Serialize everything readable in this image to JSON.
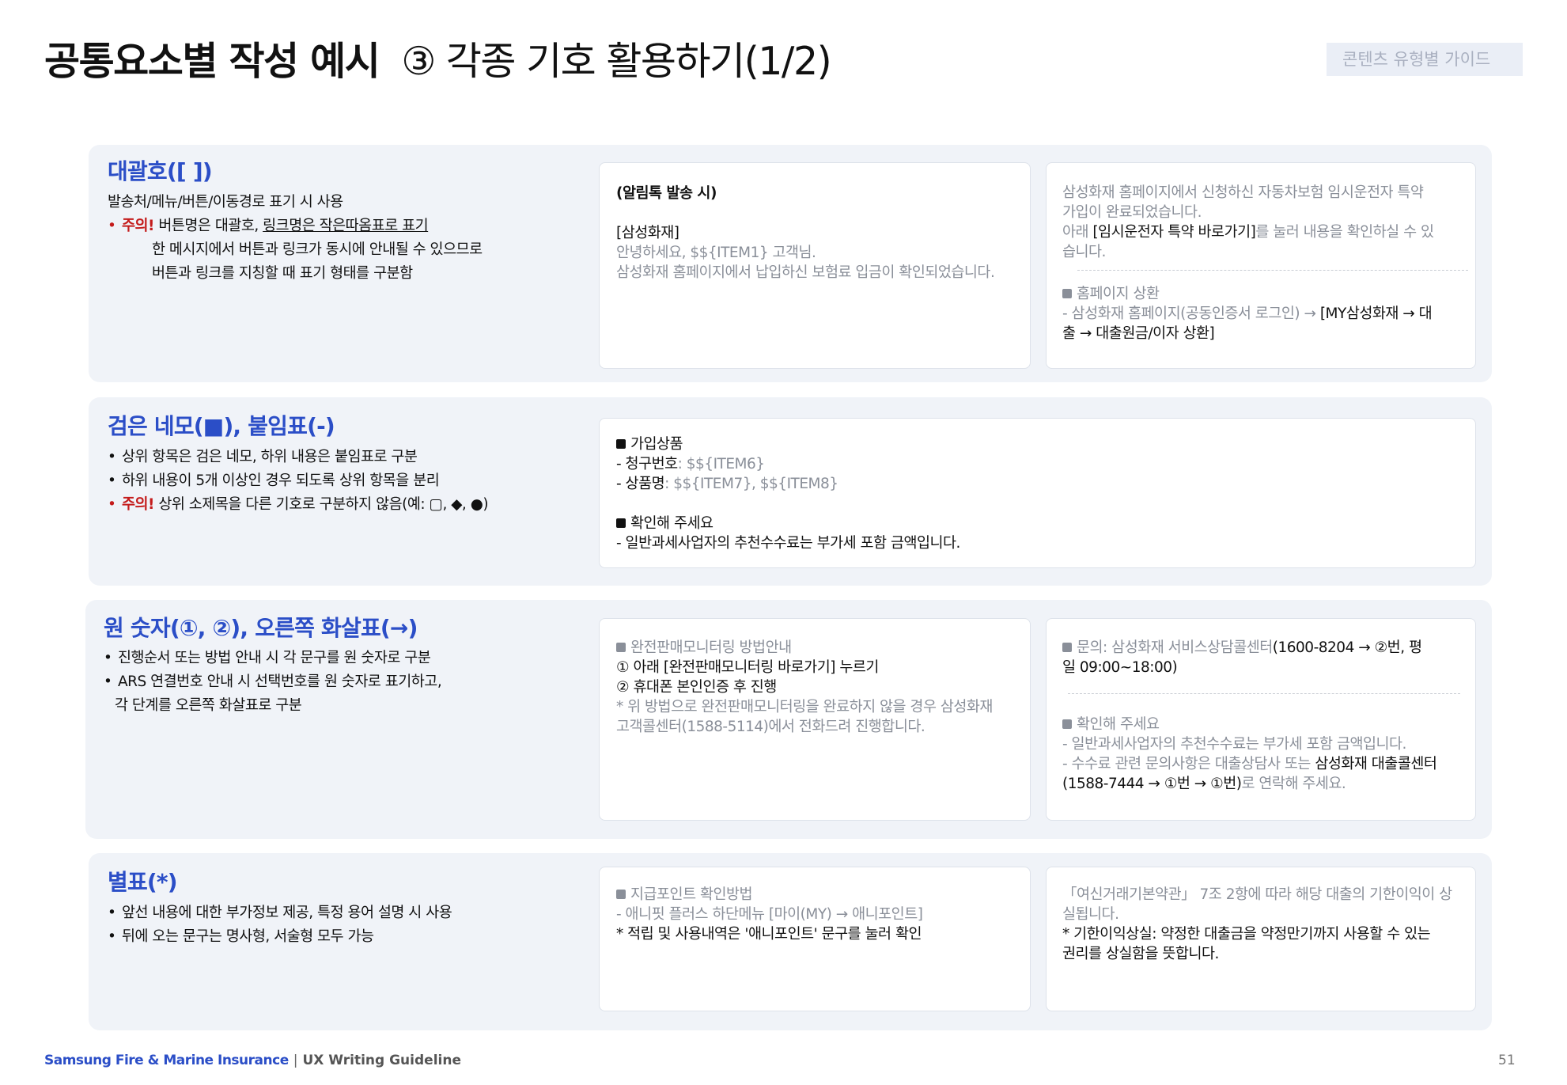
{
  "header": {
    "title_bold": "공통요소별 작성 예시",
    "title_sub": "③ 각종 기호 활용하기(1/2)",
    "guide_tag": "콘텐츠 유형별 가이드"
  },
  "sections": {
    "brackets": {
      "title": "대괄호([ ])",
      "desc_1": "발송처/메뉴/버튼/이동경로 표기 시 사용",
      "warn_label": "주의!",
      "warn_text_1": " 버튼명은 대괄호, ",
      "warn_text_u": "링크명은 작은따옴표로 표기",
      "desc_3": "한 메시지에서 버튼과 링크가 동시에 안내될 수 있으므로",
      "desc_4": "버튼과 링크를 지칭할 때 표기 형태를 구분함",
      "card1": {
        "l1": "(알림톡 발송 시)",
        "l2": "[삼성화재]",
        "l3": "안녕하세요, $${ITEM1} 고객님.",
        "l4": "삼성화재 홈페이지에서 납입하신 보험료 입금이 확인되었습니다."
      },
      "card2": {
        "l1": "삼성화재 홈페이지에서 신청하신 자동차보험 임시운전자 특약",
        "l2": "가입이 완료되었습니다.",
        "l3a": "아래 ",
        "l3b": "[임시운전자 특약 바로가기]",
        "l3c": "를 눌러 내용을 확인하실 수 있",
        "l4": "습니다.",
        "l5": "홈페이지 상환",
        "l6a": "- 삼성화재 홈페이지(공동인증서 로그인) → ",
        "l6b": "[MY삼성화재 → 대",
        "l7": "출 → 대출원금/이자 상환]"
      }
    },
    "squares": {
      "title": "검은 네모(■), 붙임표(-)",
      "d1": "상위 항목은 검은 네모, 하위 내용은 붙임표로 구분",
      "d2": "하위 내용이 5개 이상인 경우 되도록 상위 항목을 분리",
      "warn_label": "주의!",
      "d3": " 상위 소제목을 다른 기호로 구분하지 않음(예: ▢, ◆, ●)",
      "card": {
        "l1": "가입상품",
        "l2a": "- 청구번호",
        "l2b": ": $${ITEM6}",
        "l3a": "- 상품명",
        "l3b": ": $${ITEM7}, $${ITEM8}",
        "l4": "확인해 주세요",
        "l5": "- 일반과세사업자의 추천수수료는 부가세 포함 금액입니다."
      }
    },
    "numbers": {
      "title": "원 숫자(①, ②), 오른쪽 화살표(→)",
      "d1": "진행순서 또는 방법 안내 시 각 문구를 원 숫자로 구분",
      "d2": "ARS 연결번호 안내 시 선택번호를 원 숫자로 표기하고,",
      "d3": "각 단계를 오른쪽 화살표로 구분",
      "card1": {
        "l1": "완전판매모니터링 방법안내",
        "l2": "① 아래 [완전판매모니터링 바로가기] 누르기",
        "l3": "② 휴대폰 본인인증 후 진행",
        "l4": "* 위 방법으로 완전판매모니터링을 완료하지 않을 경우 삼성화재",
        "l5": "고객콜센터(1588-5114)에서 전화드려 진행합니다."
      },
      "card2": {
        "l1a": "문의: 삼성화재 서비스상담콜센터",
        "l1b": "(1600-8204 → ②번, 평",
        "l2": "일 09:00~18:00)",
        "l3": "확인해 주세요",
        "l4": "- 일반과세사업자의 추천수수료는 부가세 포함 금액입니다.",
        "l5a": "- 수수료 관련 문의사항은 대출상담사 또는 ",
        "l5b": "삼성화재 대출콜센터",
        "l6a": "(1588-7444 → ①번 → ①번)",
        "l6b": "로 연락해 주세요."
      }
    },
    "asterisk": {
      "title": "별표(*)",
      "d1": "앞선 내용에 대한 부가정보 제공, 특정 용어 설명 시 사용",
      "d2": "뒤에 오는 문구는 명사형, 서술형 모두 가능",
      "card1": {
        "l1": "지급포인트 확인방법",
        "l2": "- 애니핏 플러스 하단메뉴 [마이(MY) → 애니포인트]",
        "l3": "* 적립 및 사용내역은 '애니포인트' 문구를 눌러 확인"
      },
      "card2": {
        "l1": "「여신거래기본약관」 7조 2항에 따라 해당 대출의 기한이익이 상",
        "l2": "실됩니다.",
        "l3": "* 기한이익상실: 약정한 대출금을 약정만기까지 사용할 수 있는",
        "l4": "권리를 상실함을 뜻합니다."
      }
    }
  },
  "footer": {
    "brand": "Samsung Fire & Marine Insurance",
    "separator": "|",
    "guide": "UX Writing Guideline",
    "page": "51"
  }
}
